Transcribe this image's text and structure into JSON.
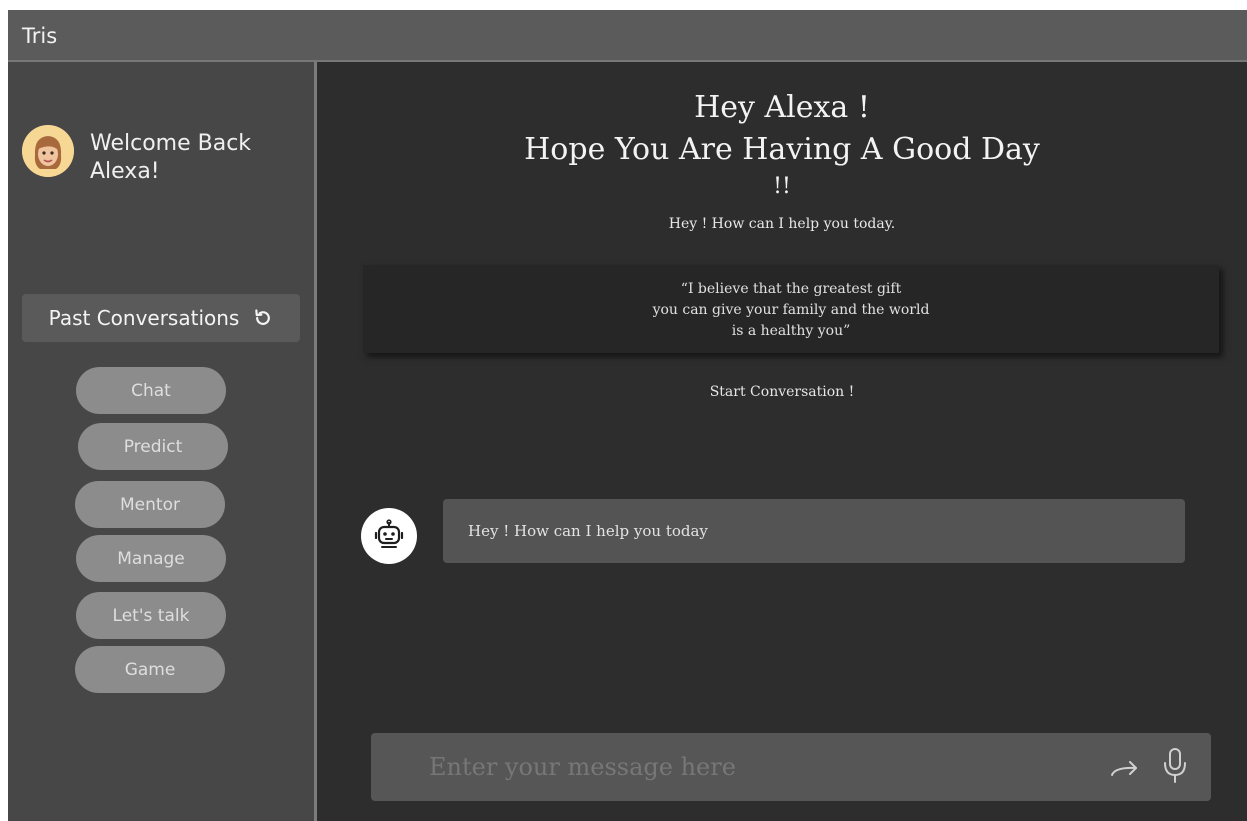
{
  "app": {
    "title": "Tris"
  },
  "sidebar": {
    "welcome_line1": "Welcome Back",
    "welcome_line2": "Alexa!",
    "past_conversations_label": "Past Conversations",
    "nav": [
      {
        "label": "Chat"
      },
      {
        "label": "Predict"
      },
      {
        "label": "Mentor"
      },
      {
        "label": "Manage"
      },
      {
        "label": "Let's talk"
      },
      {
        "label": "Game"
      }
    ]
  },
  "main": {
    "greeting_line1": "Hey Alexa !",
    "greeting_line2": "Hope You Are Having A Good Day",
    "greeting_line3": "!!",
    "subtitle": "Hey ! How can I help you today.",
    "quote_line1": "“I believe that the greatest gift",
    "quote_line2": "you can give your family and the world",
    "quote_line3": "is a healthy you”",
    "start_label": "Start Conversation !",
    "bot_message": "Hey ! How can I help you today",
    "input_placeholder": "Enter your message here"
  },
  "icons": {
    "refresh": "refresh-icon",
    "bot": "robot-icon",
    "send": "send-arrow-icon",
    "mic": "microphone-icon",
    "avatar": "user-avatar"
  },
  "colors": {
    "background": "#2d2d2d",
    "sidebar": "#474747",
    "titlebar": "#5b5b5b",
    "nav_button": "#8c8c8c",
    "bubble": "#545454"
  }
}
